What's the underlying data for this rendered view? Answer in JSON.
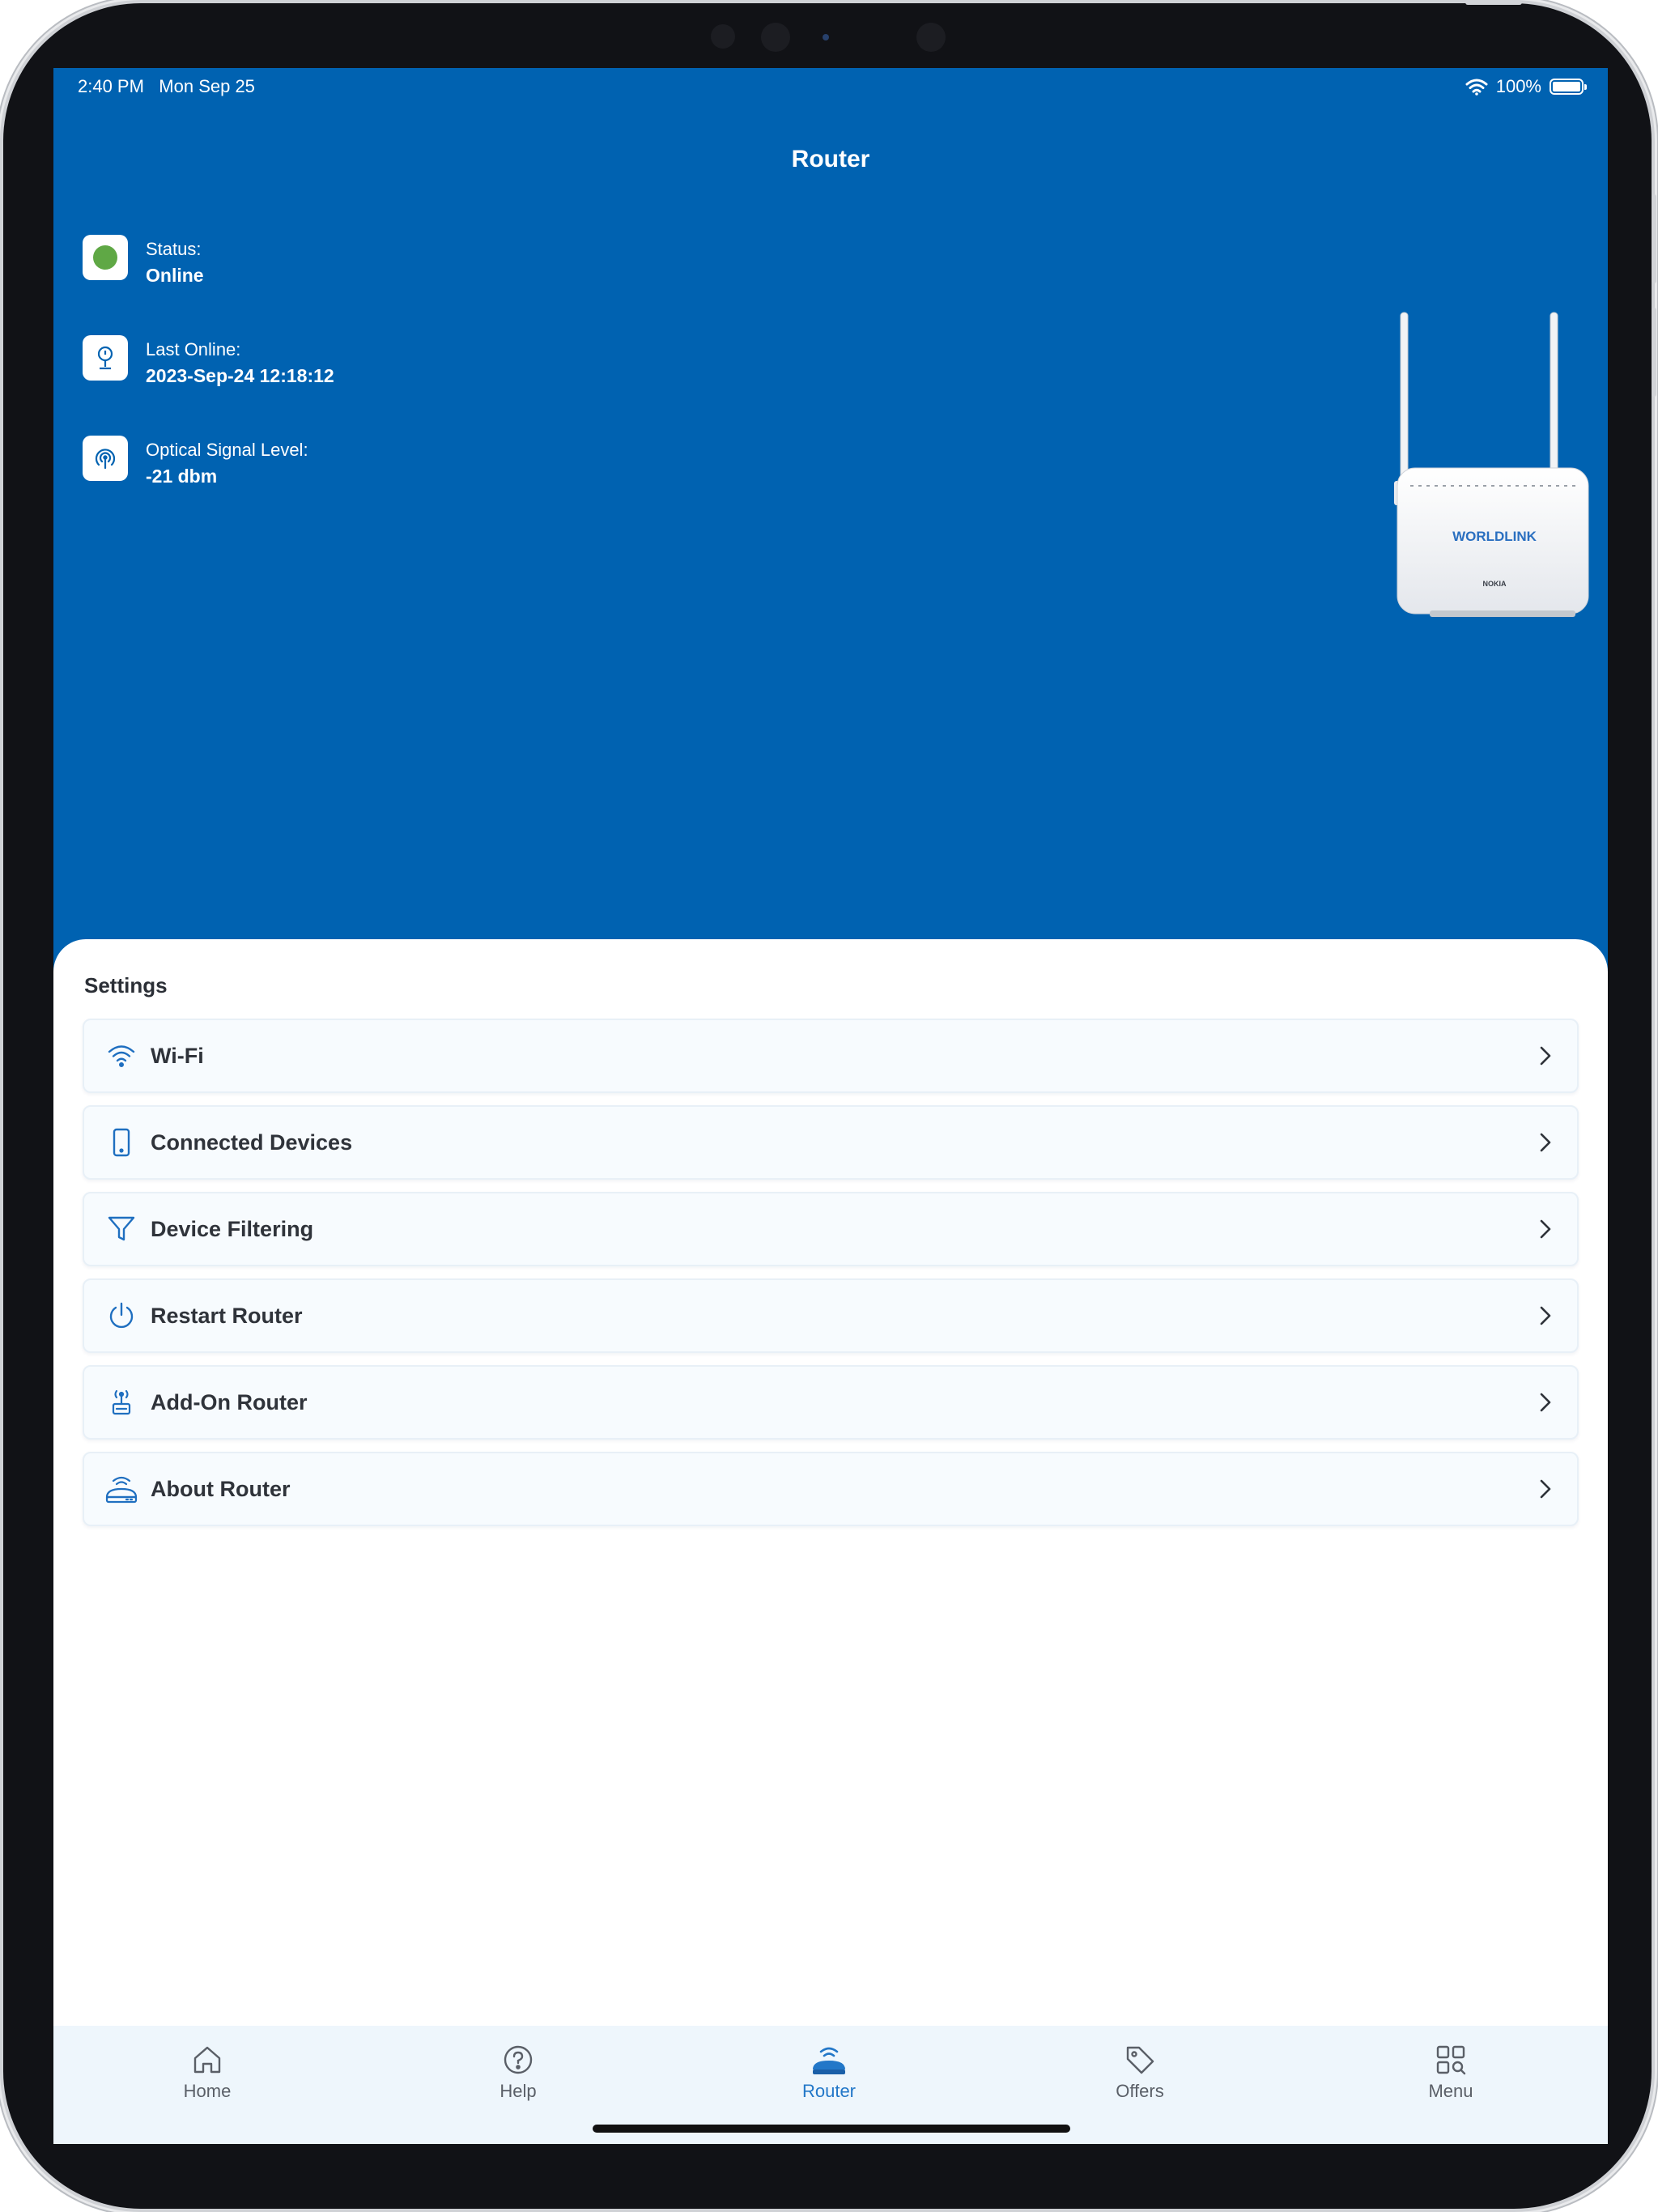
{
  "status_bar": {
    "time": "2:40 PM",
    "date": "Mon Sep 25",
    "battery": "100%"
  },
  "header": {
    "title": "Router"
  },
  "router_info": [
    {
      "label": "Status:",
      "value": "Online",
      "icon": "status-dot-icon"
    },
    {
      "label": "Last Online:",
      "value": "2023-Sep-24 12:18:12",
      "icon": "location-pin-icon"
    },
    {
      "label": "Optical Signal Level:",
      "value": "-21 dbm",
      "icon": "signal-icon"
    }
  ],
  "router_image": {
    "brand_text": "WORLDLINK",
    "maker_text": "NOKIA"
  },
  "settings": {
    "title": "Settings",
    "items": [
      {
        "label": "Wi-Fi",
        "icon": "wifi-icon"
      },
      {
        "label": "Connected Devices",
        "icon": "phone-icon"
      },
      {
        "label": "Device Filtering",
        "icon": "filter-icon"
      },
      {
        "label": "Restart Router",
        "icon": "power-icon"
      },
      {
        "label": "Add-On Router",
        "icon": "add-on-router-icon"
      },
      {
        "label": "About Router",
        "icon": "router-icon"
      }
    ]
  },
  "tabs": [
    {
      "label": "Home",
      "icon": "home-icon",
      "active": false
    },
    {
      "label": "Help",
      "icon": "help-icon",
      "active": false
    },
    {
      "label": "Router",
      "icon": "router-tab-icon",
      "active": true
    },
    {
      "label": "Offers",
      "icon": "tag-icon",
      "active": false
    },
    {
      "label": "Menu",
      "icon": "grid-icon",
      "active": false
    }
  ],
  "colors": {
    "primary": "#0062B1",
    "accent": "#2277C8",
    "online": "#5FA845",
    "tab_bg": "#EEF6FC"
  }
}
